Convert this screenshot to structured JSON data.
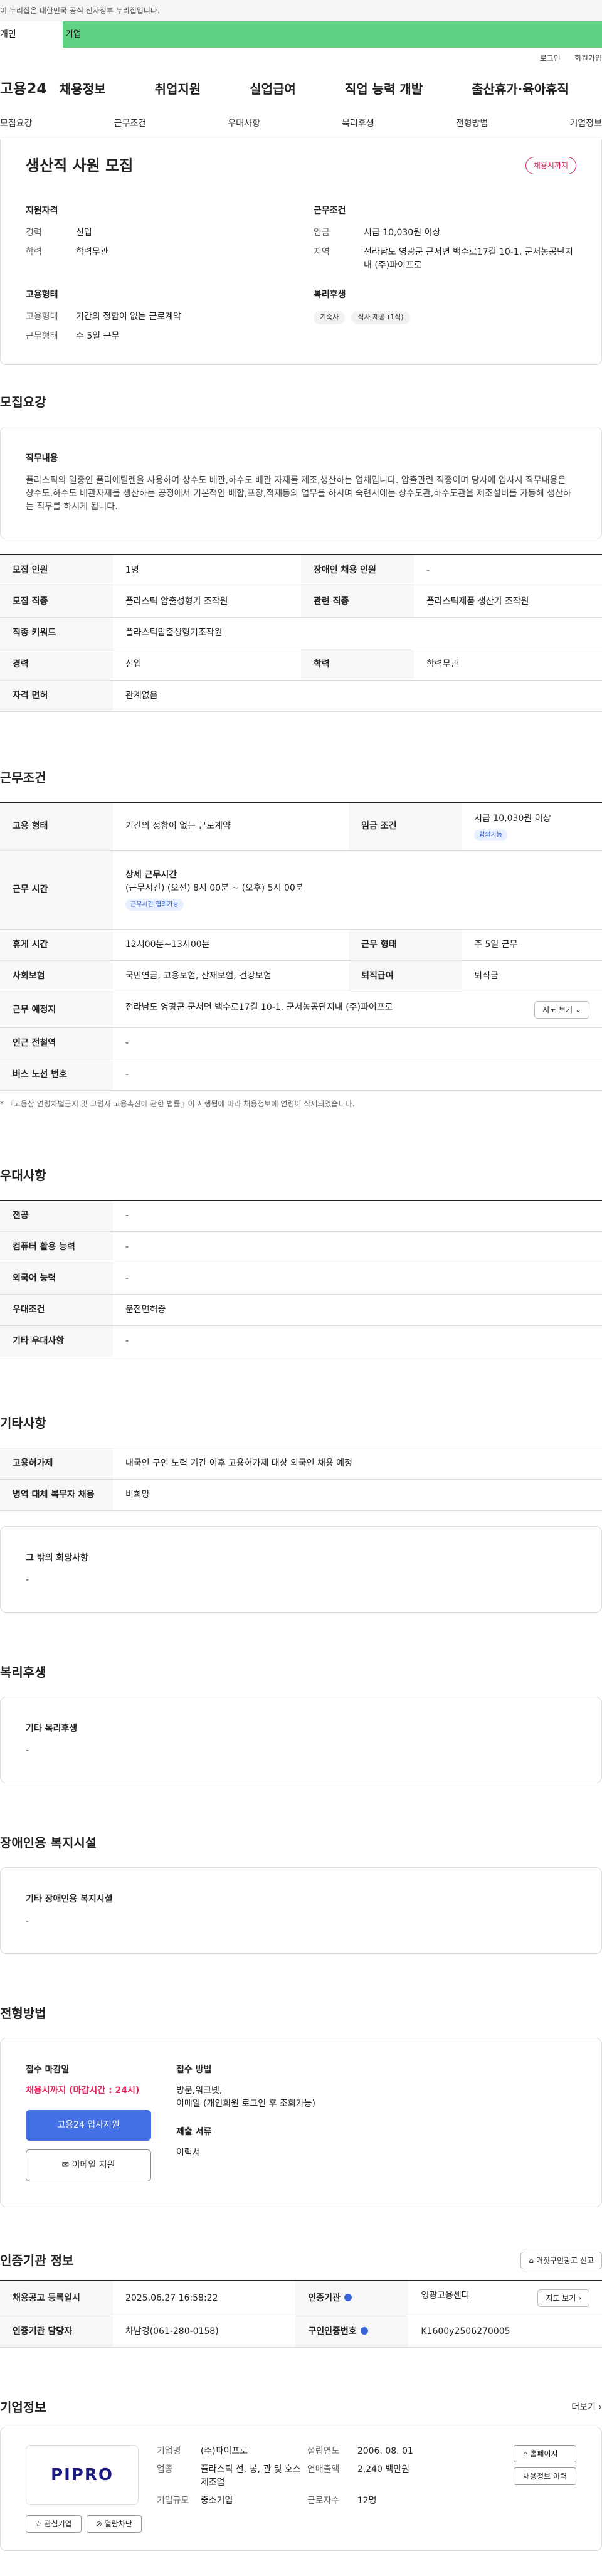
{
  "gov_notice": "이 누리집은 대한민국 공식 전자정부 누리집입니다.",
  "user_tabs": [
    "개인",
    "기업"
  ],
  "toplinks": [
    "로그인",
    "회원가입"
  ],
  "gnb": {
    "logo": "고용24",
    "items": [
      "채용정보",
      "취업지원",
      "실업급여",
      "직업 능력 개발",
      "출산휴가·육아휴직"
    ]
  },
  "subnav": [
    "모집요강",
    "근무조건",
    "우대사항",
    "복리후생",
    "전형방법",
    "기업정보"
  ],
  "summary": {
    "title": "생산직 사원 모집",
    "badge": "채용시까지",
    "qual": {
      "title": "지원자격",
      "exp_k": "경력",
      "exp_v": "신입",
      "edu_k": "학력",
      "edu_v": "학력무관"
    },
    "cond": {
      "title": "근무조건",
      "wage_k": "임금",
      "wage_v": "시급 10,030원 이상",
      "loc_k": "지역",
      "loc_v": "전라남도 영광군 군서면 백수로17길 10-1, 군서농공단지내 (주)파이프로"
    },
    "emp": {
      "title": "고용형태",
      "type_k": "고용형태",
      "type_v": "기간의 정함이 없는 근로계약",
      "week_k": "근무형태",
      "week_v": "주 5일 근무"
    },
    "welfare": {
      "title": "복리후생",
      "chips": [
        "기숙사",
        "식사 제공 (1식)"
      ]
    }
  },
  "recruit": {
    "section": "모집요강",
    "job_title": "직무내용",
    "job_desc": "플라스틱의 일종인 폴리에틸렌을 사용하여 상수도 배관,하수도 배관 자재를 제조,생산하는 업체입니다. 압출관련 직종이며 당사에 입사시 직무내용은 상수도,하수도 배관자재를 생산하는 공정에서 기본적인 배합,포장,적재등의 업무를 하시며 숙련시에는 상수도관,하수도관을 제조설비를 가동해 생산하는 직무를 하시게 됩니다.",
    "rows": [
      {
        "k1": "모집 인원",
        "v1": "1명",
        "k2": "장애인 채용 인원",
        "v2": "-"
      },
      {
        "k1": "모집 직종",
        "v1": "플라스틱 압출성형기 조작원",
        "k2": "관련 직종",
        "v2": "플라스틱제품 생산기 조작원"
      },
      {
        "k1": "직종 키워드",
        "v1": "플라스틱압출성형기조작원"
      },
      {
        "k1": "경력",
        "v1": "신입",
        "k2": "학력",
        "v2": "학력무관"
      },
      {
        "k1": "자격 면허",
        "v1": "관계없음"
      }
    ]
  },
  "conditions": {
    "section": "근무조건",
    "r1": {
      "k1": "고용 형태",
      "v1": "기간의 정함이 없는 근로계약",
      "k2": "임금 조건",
      "v2": "시급 10,030원 이상",
      "v2b": "협의가능"
    },
    "r2": {
      "k": "근무 시간",
      "title": "상세 근무시간",
      "detail": "(근무시간) (오전) 8시 00분 ~ (오후) 5시 00분",
      "chip": "근무시간 협의가능"
    },
    "r3": {
      "k1": "휴게 시간",
      "v1": "12시00분~13시00분",
      "k2": "근무 형태",
      "v2": "주 5일 근무"
    },
    "r4": {
      "k1": "사회보험",
      "v1": "국민연금, 고용보험, 산재보험, 건강보험",
      "k2": "퇴직급여",
      "v2": "퇴직금"
    },
    "r5": {
      "k": "근무 예정지",
      "v": "전라남도 영광군 군서면 백수로17길 10-1, 군서농공단지내 (주)파이프로",
      "btn": "지도 보기"
    },
    "r6": {
      "k": "인근 전철역",
      "v": "-"
    },
    "r7": {
      "k": "버스 노선 번호",
      "v": "-"
    },
    "note": "* 『고용상 연령차별금지 및 고령자 고용촉진에 관한 법률』이 시행됨에 따라 채용정보에 연령이 삭제되었습니다."
  },
  "pref": {
    "section": "우대사항",
    "rows": [
      [
        "전공",
        "-"
      ],
      [
        "컴퓨터 활용 능력",
        "-"
      ],
      [
        "외국어 능력",
        "-"
      ],
      [
        "우대조건",
        "운전면허증"
      ],
      [
        "기타 우대사항",
        "-"
      ]
    ]
  },
  "etc": {
    "section": "기타사항",
    "rows": [
      [
        "고용허가제",
        "내국인 구인 노력 기간 이후 고용허가제 대상 외국인 채용 예정"
      ],
      [
        "병역 대체 복무자 채용",
        "비희망"
      ]
    ],
    "box_title": "그 밖의 희망사항",
    "box_v": "-"
  },
  "welfare": {
    "section": "복리후생",
    "title": "기타 복리후생",
    "v": "-"
  },
  "disabled": {
    "section": "장애인용 복지시설",
    "title": "기타 장애인용 복지시설",
    "v": "-"
  },
  "process": {
    "section": "전형방법",
    "deadline_title": "접수 마감일",
    "deadline": "채용시까지 (마감시간 : 24시)",
    "apply_btn": "고용24 입사지원",
    "email_btn": "이메일 지원",
    "method_title": "접수 방법",
    "method": "방문,워크넷,",
    "method2": "이메일 (개인회원 로그인 후 조회가능)",
    "docs_title": "제출 서류",
    "docs": "이력서"
  },
  "agency": {
    "section": "인증기관 정보",
    "report": "거짓구인광고 신고",
    "r1": {
      "k1": "채용공고 등록일시",
      "v1": "2025.06.27 16:58:22",
      "k2": "인증기관",
      "v2": "영광고용센터",
      "btn": "지도 보기"
    },
    "r2": {
      "k1": "인증기관 담당자",
      "v1": "차남경(061-280-0158)",
      "k2": "구인인증번호",
      "v2": "K1600y2506270005"
    }
  },
  "company": {
    "section": "기업정보",
    "more": "더보기",
    "logo": "PIPRO",
    "fav": "관심기업",
    "block": "열람차단",
    "name_k": "기업명",
    "name_v": "(주)파이프로",
    "biz_k": "업종",
    "biz_v": "플라스틱 선, 봉, 관 및 호스 제조업",
    "size_k": "기업규모",
    "size_v": "중소기업",
    "year_k": "설립연도",
    "year_v": "2006. 08. 01",
    "sales_k": "연매출액",
    "sales_v": "2,240 백만원",
    "emp_k": "근로자수",
    "emp_v": "12명",
    "home_btn": "홈페이지",
    "hist_btn": "채용정보 이력"
  }
}
